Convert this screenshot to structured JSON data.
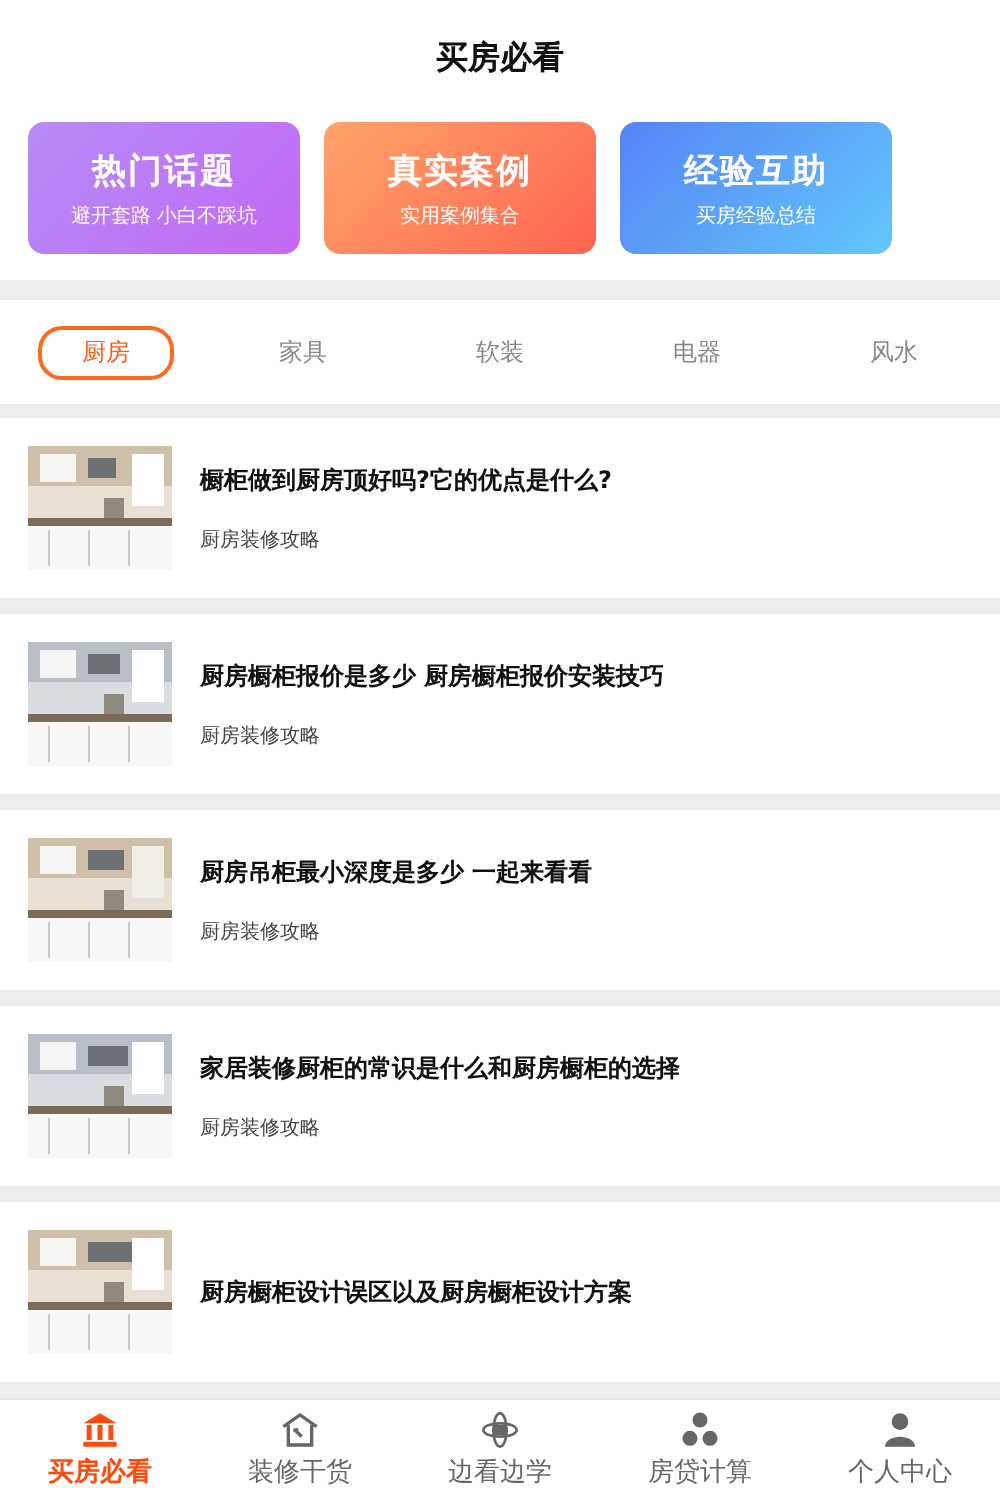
{
  "header": {
    "title": "买房必看"
  },
  "cards": [
    {
      "title": "热门话题",
      "subtitle": "避开套路 小白不踩坑"
    },
    {
      "title": "真实案例",
      "subtitle": "实用案例集合"
    },
    {
      "title": "经验互助",
      "subtitle": "买房经验总结"
    }
  ],
  "tabs": [
    {
      "label": "厨房",
      "selected": true
    },
    {
      "label": "家具",
      "selected": false
    },
    {
      "label": "软装",
      "selected": false
    },
    {
      "label": "电器",
      "selected": false
    },
    {
      "label": "风水",
      "selected": false
    }
  ],
  "articles": [
    {
      "title": "橱柜做到厨房顶好吗?它的优点是什么?",
      "tag": "厨房装修攻略"
    },
    {
      "title": "厨房橱柜报价是多少 厨房橱柜报价安装技巧",
      "tag": "厨房装修攻略"
    },
    {
      "title": "厨房吊柜最小深度是多少 一起来看看",
      "tag": "厨房装修攻略"
    },
    {
      "title": "家居装修厨柜的常识是什么和厨房橱柜的选择",
      "tag": "厨房装修攻略"
    },
    {
      "title": "厨房橱柜设计误区以及厨房橱柜设计方案"
    }
  ],
  "nav": [
    {
      "label": "买房必看",
      "kind": "bank",
      "selected": true
    },
    {
      "label": "装修干货",
      "kind": "house",
      "selected": false
    },
    {
      "label": "边看边学",
      "kind": "atom",
      "selected": false
    },
    {
      "label": "房贷计算",
      "kind": "coins",
      "selected": false
    },
    {
      "label": "个人中心",
      "kind": "person",
      "selected": false
    }
  ]
}
